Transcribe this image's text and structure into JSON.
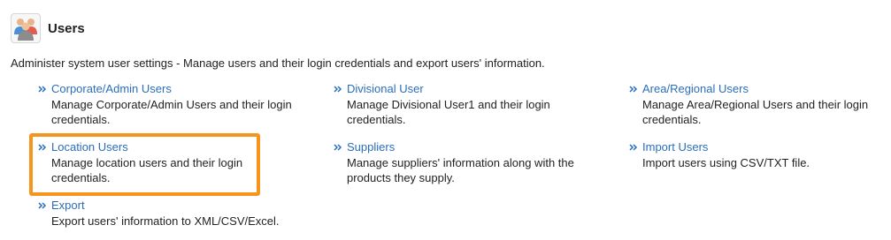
{
  "header": {
    "title": "Users",
    "icon": "users-group-icon"
  },
  "description": "Administer system user settings - Manage users and their login credentials and export users' information.",
  "colors": {
    "link": "#2a6ebb",
    "highlight": "#f7941d"
  },
  "items": [
    {
      "name": "corporate-admin-users",
      "label": "Corporate/Admin Users",
      "desc": "Manage Corporate/Admin Users and their login credentials."
    },
    {
      "name": "divisional-user",
      "label": "Divisional User",
      "desc": "Manage Divisional User1 and their login credentials."
    },
    {
      "name": "area-regional-users",
      "label": "Area/Regional Users",
      "desc": "Manage Area/Regional Users and their login credentials."
    },
    {
      "name": "location-users",
      "label": "Location Users",
      "desc": "Manage location users and their login credentials."
    },
    {
      "name": "suppliers",
      "label": "Suppliers",
      "desc": "Manage suppliers' information along with the products they supply."
    },
    {
      "name": "import-users",
      "label": "Import Users",
      "desc": "Import users using CSV/TXT file."
    },
    {
      "name": "export",
      "label": "Export",
      "desc": "Export users' information to XML/CSV/Excel."
    }
  ]
}
